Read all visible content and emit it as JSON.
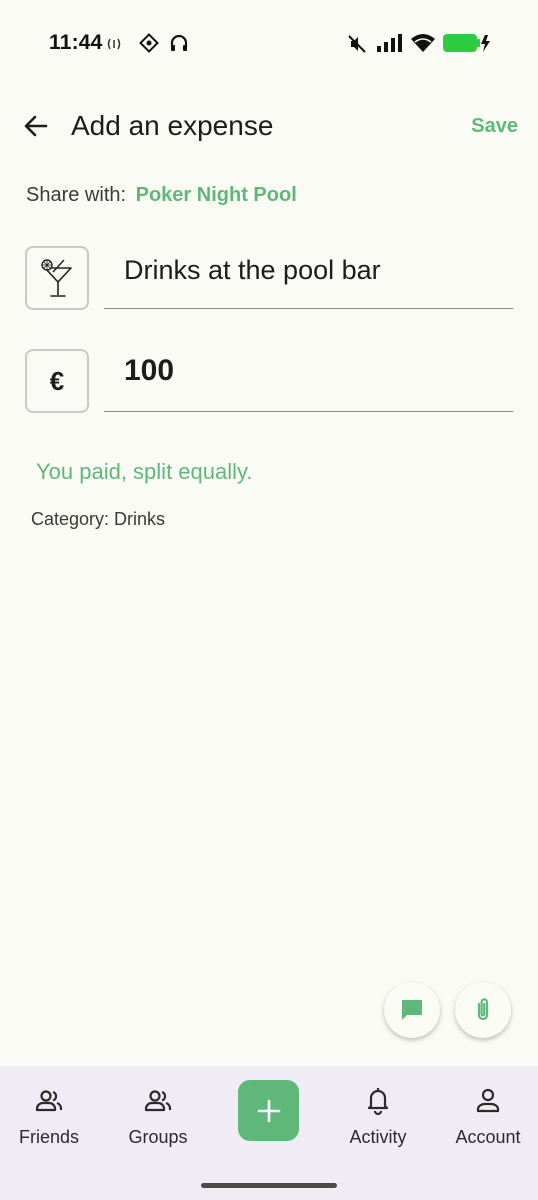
{
  "status_bar": {
    "time": "11:44",
    "icons": [
      "nfc-icon",
      "app-icon",
      "headphones-icon",
      "mute-icon",
      "signal-icon",
      "wifi-icon",
      "battery-charging-icon"
    ]
  },
  "header": {
    "title": "Add an expense",
    "save_label": "Save",
    "back_icon": "arrow-left-icon"
  },
  "share": {
    "prefix": "Share with:",
    "group": "Poker Night Pool"
  },
  "expense": {
    "category_icon": "cocktail-icon",
    "description": "Drinks at the pool bar",
    "currency_symbol": "€",
    "amount": "100"
  },
  "split_text": "You paid, split equally.",
  "category_text": "Category: Drinks",
  "actions": [
    "note-icon",
    "attachment-icon"
  ],
  "bottom_nav": {
    "items": [
      {
        "label": "Friends",
        "icon": "friends-icon"
      },
      {
        "label": "Groups",
        "icon": "groups-icon"
      },
      {
        "label": "Activity",
        "icon": "bell-icon"
      },
      {
        "label": "Account",
        "icon": "account-icon"
      }
    ],
    "add_icon": "plus-icon"
  },
  "colors": {
    "accent": "#5fb87a",
    "background": "#fbfbf5",
    "nav_background": "#f0ecf5"
  }
}
